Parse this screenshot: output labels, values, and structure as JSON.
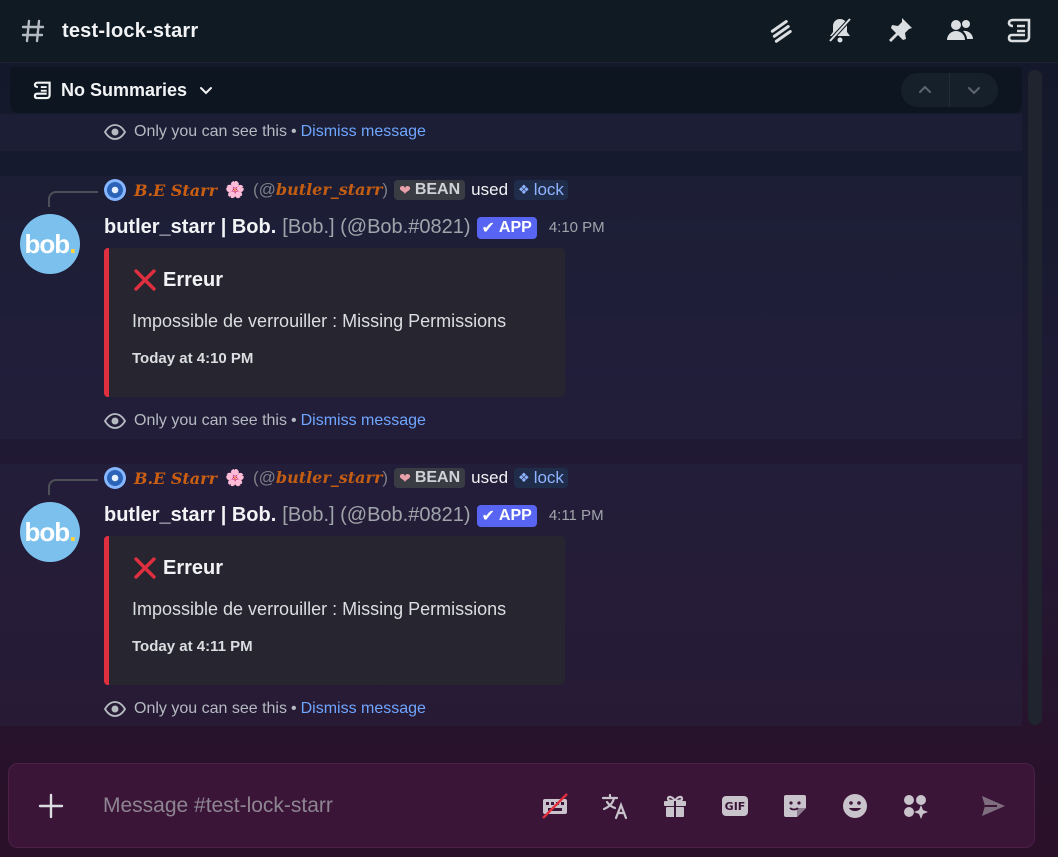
{
  "header": {
    "channel_name": "test-lock-starr",
    "icons": [
      "threads-icon",
      "notification-bell-muted-icon",
      "pin-icon",
      "member-list-icon",
      "summaries-icon"
    ]
  },
  "summaries": {
    "label": "No Summaries",
    "nav": [
      "chevron-up-icon",
      "chevron-down-icon"
    ]
  },
  "ephemeral": {
    "text": "Only you can see this",
    "separator": "•",
    "dismiss": "Dismiss message"
  },
  "messages": [
    {
      "reply": {
        "display_name": "B.E Starr",
        "flower": "🌸",
        "username_prefix": "(@",
        "username": "butler_starr",
        "username_suffix": ")",
        "tag": "BEAN",
        "used": "used",
        "command": "lock"
      },
      "author": "butler_starr | Bob.",
      "author_suffix": "[Bob.] (@Bob.#0821)",
      "app_badge": "APP",
      "timestamp": "4:10 PM",
      "embed": {
        "title": "Erreur",
        "description": "Impossible de verrouiller : Missing Permissions",
        "footer": "Today at 4:10 PM",
        "color": "#e0303f"
      }
    },
    {
      "reply": {
        "display_name": "B.E Starr",
        "flower": "🌸",
        "username_prefix": "(@",
        "username": "butler_starr",
        "username_suffix": ")",
        "tag": "BEAN",
        "used": "used",
        "command": "lock"
      },
      "author": "butler_starr | Bob.",
      "author_suffix": "[Bob.] (@Bob.#0821)",
      "app_badge": "APP",
      "timestamp": "4:11 PM",
      "embed": {
        "title": "Erreur",
        "description": "Impossible de verrouiller : Missing Permissions",
        "footer": "Today at 4:11 PM",
        "color": "#e0303f"
      }
    }
  ],
  "avatar": {
    "text": "bob",
    "dot": ".",
    "color": "#7cc0ee"
  },
  "composer": {
    "placeholder": "Message #test-lock-starr",
    "icons": [
      "nitro-keyboard-off-icon",
      "translate-icon",
      "gift-icon",
      "gif-icon",
      "sticker-icon",
      "emoji-icon",
      "apps-icon",
      "send-icon"
    ],
    "gif_label": "GIF"
  },
  "colors": {
    "accent": "#5865f2",
    "link": "#6fa6ff",
    "error": "#e0303f"
  }
}
